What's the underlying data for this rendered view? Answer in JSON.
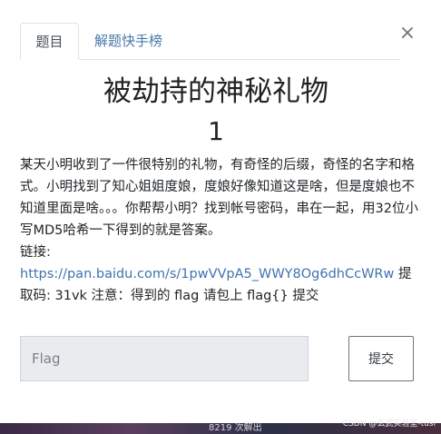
{
  "tabs": [
    {
      "label": "题目",
      "active": true
    },
    {
      "label": "解题快手榜",
      "active": false
    }
  ],
  "close_symbol": "×",
  "challenge": {
    "title": "被劫持的神秘礼物",
    "score": "1",
    "description": "某天小明收到了一件很特别的礼物，有奇怪的后缀，奇怪的名字和格式。小明找到了知心姐姐度娘，度娘好像知道这是啥，但是度娘也不知道里面是啥。。。你帮帮小明？找到帐号密码，串在一起，用32位小写MD5哈希一下得到的就是答案。",
    "link_label": "链接:",
    "link_url": "https://pan.baidu.com/s/1pwVVpA5_WWY8Og6dhCcWRw",
    "link_suffix": "提",
    "extra": "取码: 31vk 注意：得到的 flag 请包上 flag{} 提交"
  },
  "form": {
    "flag_placeholder": "Flag",
    "submit_label": "提交"
  },
  "background": {
    "left_text": "",
    "mid_text": "8219 次解出"
  },
  "watermark": "CSDN @玄武实验室-tusi"
}
